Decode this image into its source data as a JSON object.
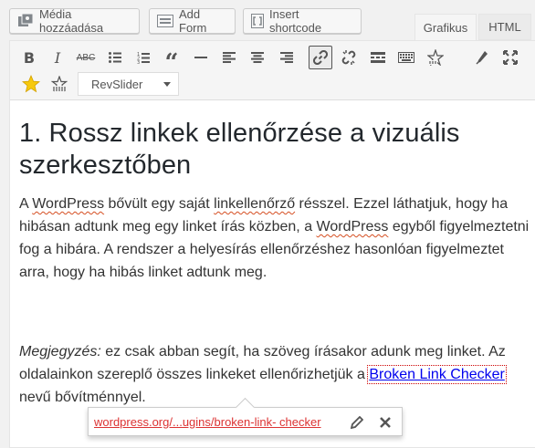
{
  "buttons": {
    "add_media": "Média hozzáadása",
    "add_form": "Add Form",
    "insert_shortcode": "Insert shortcode"
  },
  "tabs": {
    "visual": "Grafikus",
    "text": "HTML"
  },
  "toolbar": {
    "row1": [
      "bold-icon",
      "italic-icon",
      "strikethrough-icon",
      "bullet-list-icon",
      "numbered-list-icon",
      "blockquote-icon",
      "horizontal-rule-icon",
      "align-left-icon",
      "align-center-icon",
      "align-right-icon",
      "link-icon",
      "unlink-icon",
      "read-more-icon",
      "toolbar-toggle-icon",
      "shortcode-star-icon",
      "pen-icon",
      "fullscreen-icon"
    ],
    "row2": [
      "star-icon",
      "shortcode-icon"
    ],
    "revslider_label": "RevSlider",
    "link_pressed": true
  },
  "content": {
    "heading": "1. Rossz linkek ellenőrzése a vizuális szerkesztőben",
    "p1": {
      "a": "A ",
      "w1": "WordPress",
      "b": " bővült egy saját ",
      "w2": "linkellenőrző",
      "c": " résszel. Ezzel láthatjuk, hogy ha hibásan adtunk meg egy linket írás közben, a ",
      "w3": "WordPress",
      "d": " egyből figyelmeztetni fog a hibára. A rendszer a helyesírás ellenőrzéshez hasonlóan figyelmeztet arra, hogy ha hibás linket adtunk meg."
    },
    "p2": {
      "note": "Megjegyzés:",
      "a": " ez csak abban segít, ha szöveg írásakor adunk meg linket. Az oldalainkon szereplő összes linkeket ellenőrizhetjük a ",
      "link": "Broken Link Checker",
      "b": " nevű bővítménnyel."
    }
  },
  "popover": {
    "url": "wordpress.org/...ugins/broken-link- checker",
    "edit_icon": "pencil-icon",
    "remove_icon": "close-icon"
  },
  "colors": {
    "spell_underline": "#d54e21",
    "link": "#0000ee",
    "popover_url": "#dc3232"
  }
}
